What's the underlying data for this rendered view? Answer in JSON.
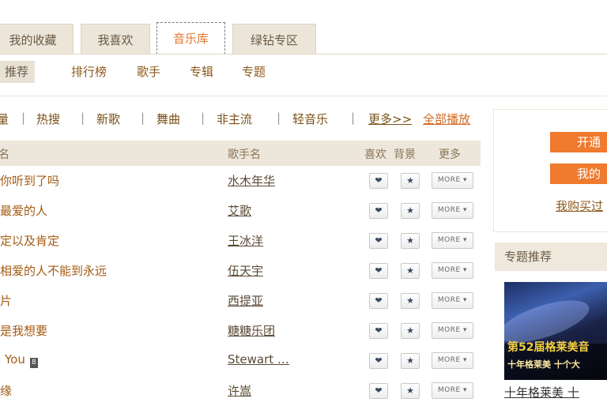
{
  "top_tabs": [
    {
      "label": "我的收藏"
    },
    {
      "label": "我喜欢"
    },
    {
      "label": "音乐库"
    },
    {
      "label": "绿钻专区"
    }
  ],
  "subnav": [
    {
      "label": "推荐"
    },
    {
      "label": "排行榜"
    },
    {
      "label": "歌手"
    },
    {
      "label": "专辑"
    },
    {
      "label": "专题"
    }
  ],
  "filters": {
    "items": [
      "量",
      "热搜",
      "新歌",
      "舞曲",
      "非主流",
      "轻音乐"
    ],
    "more": "更多>>",
    "play_all": "全部播放"
  },
  "table": {
    "headers": {
      "song": "名",
      "singer": "歌手名",
      "like": "喜欢",
      "bg": "背景",
      "more": "更多"
    },
    "rows": [
      {
        "song": "你听到了吗",
        "singer": "水木年华"
      },
      {
        "song": "最爱的人",
        "singer": "艾歌"
      },
      {
        "song": "定以及肯定",
        "singer": "王冰洋"
      },
      {
        "song": "相爱的人不能到永远",
        "singer": "伍天宇"
      },
      {
        "song": "片",
        "singer": "西提亚"
      },
      {
        "song": "是我想要",
        "singer": "糖糖乐团"
      },
      {
        "song": "You",
        "singer": "Stewart …",
        "hq": true
      },
      {
        "song": "缘",
        "singer": "许嵩"
      }
    ],
    "like_icon": "heart-icon",
    "bg_icon": "star-icon",
    "more_label": "MORE ▾",
    "hq_badge": "8"
  },
  "sidebar": {
    "open_button": "开通",
    "my_button": "我的",
    "purchased_link": "我购买过",
    "topic_title": "专题推荐",
    "topic_image_title": "第52届格莱美音",
    "topic_image_sub": "十年格莱美 十个大",
    "topic_caption": "十年格莱美 十"
  },
  "colors": {
    "accent": "#f07a2d",
    "link": "#a35b12",
    "header_bg": "#ede6db",
    "tab_bg": "#ece5da"
  }
}
